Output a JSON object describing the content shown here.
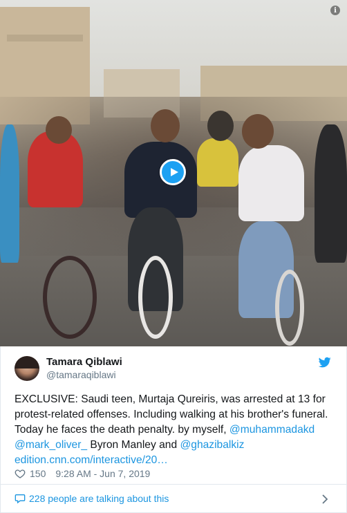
{
  "media": {
    "info_glyph": "i",
    "play_icon": "play-icon",
    "accent": "#1da1f2"
  },
  "author": {
    "display_name": "Tamara Qiblawi",
    "handle": "@tamaraqiblawi"
  },
  "tweet": {
    "text_1": "EXCLUSIVE: Saudi teen, Murtaja Qureiris, was arrested at 13 for protest-related offenses. Including walking at his brother's funeral. Today he faces the death penalty. by myself, ",
    "mention_1": "@muhammadakd",
    "sep_1": " ",
    "mention_2": "@mark_oliver_",
    "text_2": "  Byron Manley and ",
    "mention_3": "@ghazibalkiz",
    "sep_2": " ",
    "link": "edition.cnn.com/interactive/20…"
  },
  "meta": {
    "likes": "150",
    "timestamp": "9:28 AM - Jun 7, 2019"
  },
  "footer": {
    "talking": "228 people are talking about this"
  },
  "colors": {
    "link": "#1b95e0",
    "secondary_text": "#657786",
    "border": "#e1e8ed"
  }
}
